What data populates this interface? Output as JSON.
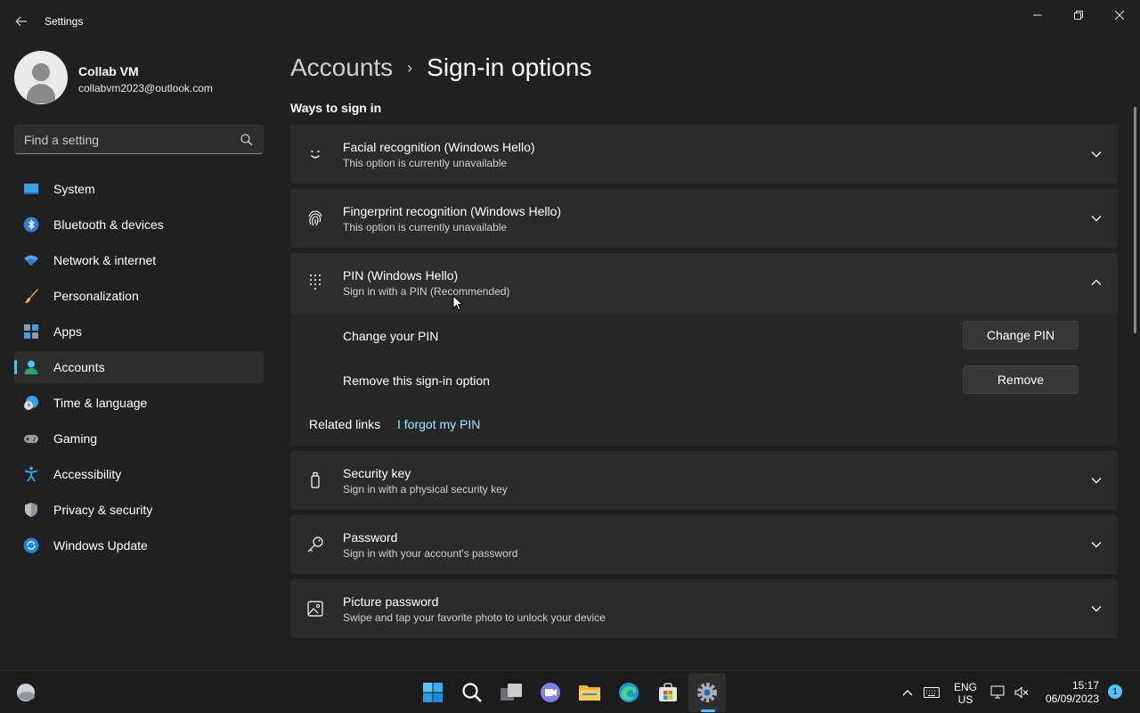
{
  "window": {
    "title": "Settings",
    "minimize_icon": "minimize-icon",
    "maximize_icon": "restore-icon",
    "close_icon": "close-icon"
  },
  "profile": {
    "name": "Collab VM",
    "email": "collabvm2023@outlook.com"
  },
  "search": {
    "placeholder": "Find a setting"
  },
  "sidebar": {
    "items": [
      {
        "label": "System",
        "icon": "system-icon",
        "active": false
      },
      {
        "label": "Bluetooth & devices",
        "icon": "bluetooth-icon",
        "active": false
      },
      {
        "label": "Network & internet",
        "icon": "wifi-icon",
        "active": false
      },
      {
        "label": "Personalization",
        "icon": "brush-icon",
        "active": false
      },
      {
        "label": "Apps",
        "icon": "apps-icon",
        "active": false
      },
      {
        "label": "Accounts",
        "icon": "accounts-icon",
        "active": true
      },
      {
        "label": "Time & language",
        "icon": "time-language-icon",
        "active": false
      },
      {
        "label": "Gaming",
        "icon": "gamepad-icon",
        "active": false
      },
      {
        "label": "Accessibility",
        "icon": "accessibility-icon",
        "active": false
      },
      {
        "label": "Privacy & security",
        "icon": "shield-icon",
        "active": false
      },
      {
        "label": "Windows Update",
        "icon": "update-icon",
        "active": false
      }
    ]
  },
  "breadcrumb": {
    "parent": "Accounts",
    "separator": "›",
    "current": "Sign-in options"
  },
  "section": {
    "title": "Ways to sign in"
  },
  "options": {
    "facial": {
      "title": "Facial recognition (Windows Hello)",
      "subtitle": "This option is currently unavailable",
      "expanded": false
    },
    "fingerprint": {
      "title": "Fingerprint recognition (Windows Hello)",
      "subtitle": "This option is currently unavailable",
      "expanded": false
    },
    "pin": {
      "title": "PIN (Windows Hello)",
      "subtitle": "Sign in with a PIN (Recommended)",
      "expanded": true,
      "change_label": "Change your PIN",
      "change_button": "Change PIN",
      "remove_label": "Remove this sign-in option",
      "remove_button": "Remove",
      "related_label": "Related links",
      "forgot_link": "I forgot my PIN"
    },
    "security_key": {
      "title": "Security key",
      "subtitle": "Sign in with a physical security key",
      "expanded": false
    },
    "password": {
      "title": "Password",
      "subtitle": "Sign in with your account's password",
      "expanded": false
    },
    "picture_password": {
      "title": "Picture password",
      "subtitle": "Swipe and tap your favorite photo to unlock your device",
      "expanded": false
    }
  },
  "taskbar": {
    "apps": [
      "start-icon",
      "search-icon",
      "task-view-icon",
      "teams-chat-icon",
      "file-explorer-icon",
      "edge-icon",
      "store-icon",
      "settings-icon"
    ],
    "active_app": "settings-icon",
    "tray": {
      "lang_line1": "ENG",
      "lang_line2": "US",
      "time": "15:17",
      "date": "06/09/2023",
      "notification_count": "1"
    }
  },
  "colors": {
    "accent": "#4cc2ff",
    "link": "#99ebff",
    "background": "#202020",
    "card": "#2b2b2b"
  }
}
